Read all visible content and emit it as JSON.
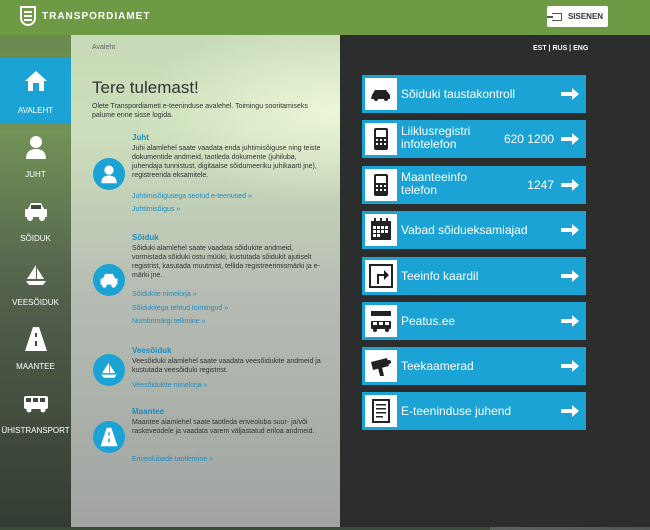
{
  "header": {
    "logo_text": "TRANSPORDIAMET",
    "login_label": "SISENEN"
  },
  "sidebar": {
    "items": [
      {
        "label": "AVALEHT",
        "icon": "home-icon",
        "active": true
      },
      {
        "label": "JUHT",
        "icon": "driver-icon"
      },
      {
        "label": "SÕIDUK",
        "icon": "car-icon"
      },
      {
        "label": "VEESÕIDUK",
        "icon": "sailboat-icon"
      },
      {
        "label": "MAANTEE",
        "icon": "road-icon"
      },
      {
        "label": "ÜHISTRANSPORT",
        "icon": "bus-icon"
      }
    ]
  },
  "main": {
    "breadcrumb": "Avaleht",
    "title": "Tere tulemast!",
    "intro": "Olete Transpordiameti e-teeninduse avalehel. Toimingu sooritamiseks palume enne sisse logida.",
    "sections": [
      {
        "heading": "Juht",
        "text": "Juhi alamlehel saate vaadata enda juhtimisõiguse ning teiste dokumentide andmeid, taotleda dokumente (juhiluba, juhendaja tunnistust, digitaalse sõidumeeriku juhikaarti jne), registreerida eksamitele.",
        "links": [
          "Juhtimisõigusega seotud e-teenused »",
          "Juhtimisõigus »"
        ],
        "icon": "driver-icon"
      },
      {
        "heading": "Sõiduk",
        "text": "Sõiduki alamlehel saate vaadata sõidukite andmeid, vormistada sõiduki ostu müüki, kustutada sõidukit ajutiselt registrist, kasutada muutmist, tellida registreerimismärki ja e-märki jne.",
        "links": [
          "Sõidukite nimekirja »",
          "Sõidukitega tehtud toimingud »",
          "Numbrimärgi tellimine »"
        ],
        "icon": "car-icon"
      },
      {
        "heading": "Veesõiduk",
        "text": "Veesõiduki alamlehel saate vaadata veesõidukite andmeid ja kustutada veesõiduki registrist.",
        "links": [
          "Veesõidukite nimekirja »"
        ],
        "icon": "sailboat-icon"
      },
      {
        "heading": "Maantee",
        "text": "Maantee alamlehel saate taotleda eriveoluba suur- ja/või raskeveodele ja vaadata varem väljastatud eriloa andmeid.",
        "links": [
          "Eriveolubade taotlemine »"
        ],
        "icon": "road-icon"
      }
    ]
  },
  "lang": "EST | RUS | ENG",
  "quick_links": [
    {
      "label": "Sõiduki taustakontroll",
      "icon": "car-check-icon"
    },
    {
      "label": "Liiklusregistri infotelefon",
      "number": "620 1200",
      "icon": "phone-icon"
    },
    {
      "label": "Maanteeinfo telefon",
      "number": "1247",
      "icon": "phone-icon"
    },
    {
      "label": "Vabad sõidueksamiajad",
      "icon": "calendar-icon"
    },
    {
      "label": "Teeinfo kaardil",
      "icon": "road-sign-icon"
    },
    {
      "label": "Peatus.ee",
      "icon": "bus-stop-icon"
    },
    {
      "label": "Teekaamerad",
      "icon": "camera-icon"
    },
    {
      "label": "E-teeninduse juhend",
      "icon": "document-icon"
    }
  ],
  "colors": {
    "accent": "#1aa3d4",
    "topbar": "#6f9a45",
    "dark_panel": "#2b2e2d"
  }
}
